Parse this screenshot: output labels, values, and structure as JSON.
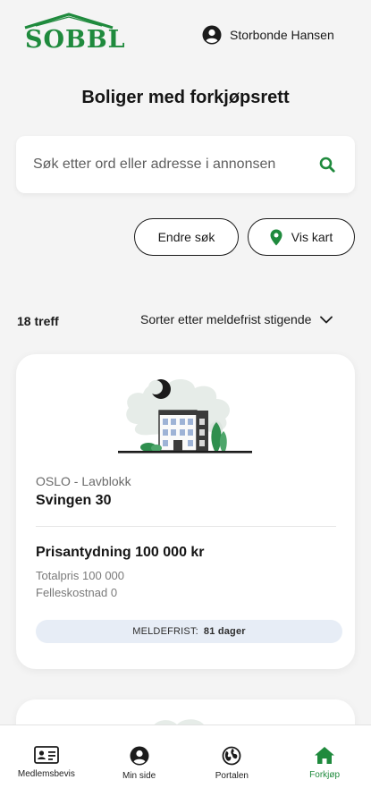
{
  "header": {
    "logo_text": "SOBBL",
    "user_name": "Storbonde Hansen"
  },
  "page_title": "Boliger med forkjøpsrett",
  "search": {
    "placeholder": "Søk etter ord eller adresse i annonsen",
    "value": ""
  },
  "actions": {
    "edit_search": "Endre søk",
    "show_map": "Vis kart"
  },
  "results": {
    "hits": "18 treff",
    "sort_label": "Sorter etter meldefrist stigende"
  },
  "listings": [
    {
      "location": "OSLO - Lavblokk",
      "address": "Svingen 30",
      "price": "Prisantydning 100 000 kr",
      "total_price": "Totalpris 100 000",
      "shared_cost": "Felleskostnad 0",
      "deadline_label": "MELDEFRIST:",
      "deadline_value": "81 dager"
    }
  ],
  "tabs": [
    {
      "label": "Medlemsbevis",
      "icon": "id-card-icon"
    },
    {
      "label": "Min side",
      "icon": "user-circle-icon"
    },
    {
      "label": "Portalen",
      "icon": "globe-icon"
    },
    {
      "label": "Forkjøp",
      "icon": "home-icon"
    }
  ],
  "colors": {
    "brand_green": "#1f8a3d",
    "background": "#f4f4f4",
    "deadline_bg": "#e7edf6"
  }
}
